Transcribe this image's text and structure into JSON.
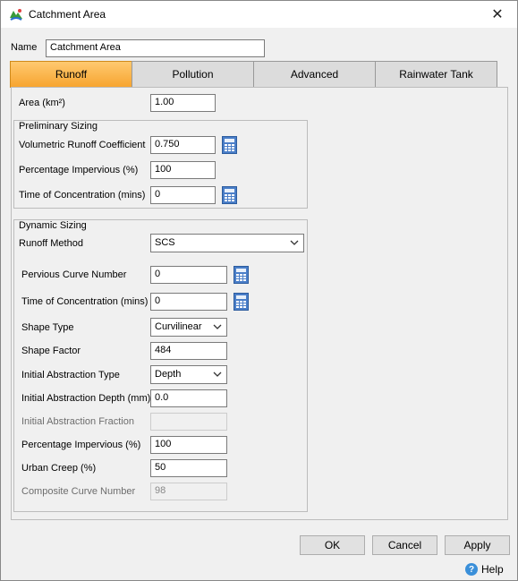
{
  "window": {
    "title": "Catchment Area",
    "close_glyph": "✕"
  },
  "name": {
    "label": "Name",
    "value": "Catchment Area"
  },
  "tabs": [
    {
      "label": "Runoff",
      "active": true
    },
    {
      "label": "Pollution",
      "active": false
    },
    {
      "label": "Advanced",
      "active": false
    },
    {
      "label": "Rainwater Tank",
      "active": false
    }
  ],
  "area": {
    "label": "Area (km²)",
    "value": "1.00"
  },
  "preliminary": {
    "title": "Preliminary Sizing",
    "vrc_label": "Volumetric Runoff Coefficient",
    "vrc_value": "0.750",
    "pi_label": "Percentage Impervious (%)",
    "pi_value": "100",
    "tc_label": "Time of Concentration (mins)",
    "tc_value": "0"
  },
  "dynamic": {
    "title": "Dynamic Sizing",
    "method_label": "Runoff Method",
    "method_value": "SCS",
    "pcn_label": "Pervious Curve Number",
    "pcn_value": "0",
    "tc_label": "Time of Concentration (mins)",
    "tc_value": "0",
    "shape_type_label": "Shape Type",
    "shape_type_value": "Curvilinear",
    "shape_factor_label": "Shape Factor",
    "shape_factor_value": "484",
    "ia_type_label": "Initial Abstraction Type",
    "ia_type_value": "Depth",
    "ia_depth_label": "Initial Abstraction Depth (mm)",
    "ia_depth_value": "0.0",
    "ia_fraction_label": "Initial Abstraction Fraction",
    "ia_fraction_value": "",
    "pi_label": "Percentage Impervious (%)",
    "pi_value": "100",
    "urban_label": "Urban Creep (%)",
    "urban_value": "50",
    "ccn_label": "Composite Curve Number",
    "ccn_value": "98"
  },
  "buttons": {
    "ok": "OK",
    "cancel": "Cancel",
    "apply": "Apply",
    "help": "Help"
  },
  "icons": {
    "app": "catchment-app-icon",
    "calculator": "calculator-icon",
    "help": "help-icon",
    "dropdown": "chevron-down-icon"
  },
  "colors": {
    "active_tab": "#f7a530",
    "calculator": "#4a7ec8"
  }
}
